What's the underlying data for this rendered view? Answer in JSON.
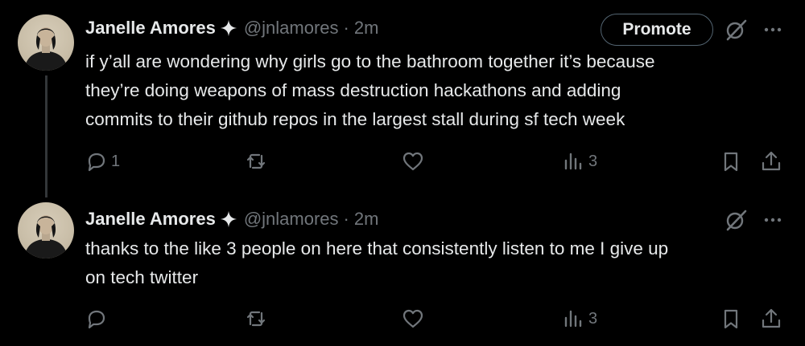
{
  "tweets": [
    {
      "author_name": "Janelle Amores",
      "handle": "@jnlamores",
      "separator": "·",
      "time": "2m",
      "promote_label": "Promote",
      "text": "if y’all are wondering why girls go to the bathroom together it’s because\nthey’re doing weapons of mass destruction hackathons and adding\ncommits to their github repos in the largest stall during sf tech week",
      "reply_count": "1",
      "views_count": "3"
    },
    {
      "author_name": "Janelle Amores",
      "handle": "@jnlamores",
      "separator": "·",
      "time": "2m",
      "text": "thanks to the like 3 people on here that consistently listen to me I give up\non tech twitter",
      "reply_count": "",
      "views_count": "3"
    }
  ],
  "colors": {
    "background": "#000000",
    "primary_text": "#e7e9ea",
    "secondary_text": "#71767b",
    "thread_line": "#333639",
    "button_border": "#536471"
  },
  "icons": [
    "verified-icon",
    "grok-icon",
    "more-icon",
    "reply-icon",
    "retweet-icon",
    "like-icon",
    "views-icon",
    "bookmark-icon",
    "share-icon"
  ]
}
